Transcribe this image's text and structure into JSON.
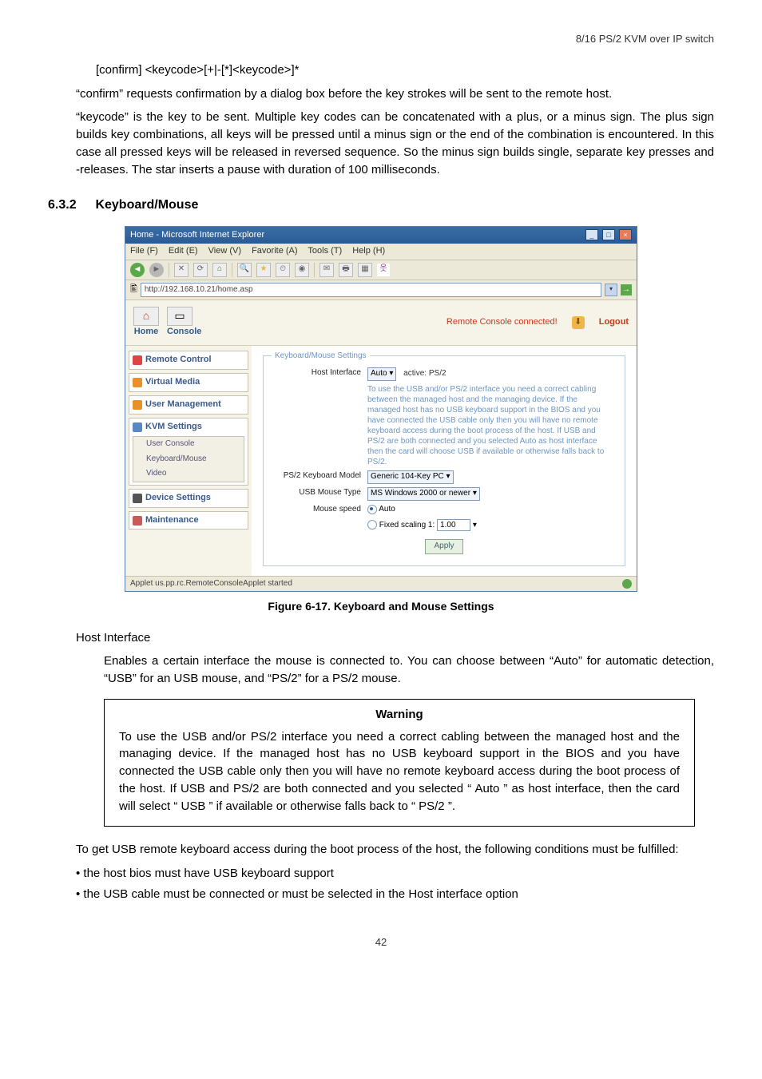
{
  "header_right": "8/16 PS/2 KVM over IP switch",
  "code_line": "[confirm] <keycode>[+|-[*]<keycode>]*",
  "para_confirm": "“confirm” requests confirmation by a dialog box before the key strokes will be sent to the remote host.",
  "para_keycode": "“keycode” is the key to be sent. Multiple key codes can be concatenated with a plus, or a minus sign. The plus sign builds key combinations, all keys will be pressed until a minus sign or the end of the combination is encountered. In this case all pressed keys will be released in reversed sequence. So the minus sign builds single, separate key presses and -releases. The star inserts a pause with duration of 100 milliseconds.",
  "section_num": "6.3.2",
  "section_title": "Keyboard/Mouse",
  "figure_caption": "Figure 6-17. Keyboard and Mouse Settings",
  "sub_heading": "Host Interface",
  "para_host_interface": "Enables a certain interface the mouse is connected to. You can choose between “Auto” for automatic detection, “USB” for an USB mouse, and “PS/2” for a PS/2 mouse.",
  "warning_title": "Warning",
  "warning_body": "To use the USB and/or PS/2 interface you need a correct cabling between the managed host and the managing device. If the managed host has no USB keyboard support in the BIOS and you have connected the USB cable only then you will have no remote keyboard access during the boot process of the host. If USB and PS/2 are both connected and you selected “ Auto ” as host interface, then the card will select “ USB ” if available or otherwise falls back to “ PS/2 ”.",
  "para_conditions": "To get USB remote keyboard access during the boot process of the host, the following conditions must be fulfilled:",
  "bullet1": "•  the host bios must have USB keyboard support",
  "bullet2": "•  the USB cable must be connected or must be selected in the Host interface option",
  "page_number": "42",
  "browser": {
    "title": "Home - Microsoft Internet Explorer",
    "menu": {
      "file": "File (F)",
      "edit": "Edit (E)",
      "view": "View (V)",
      "fav": "Favorite (A)",
      "tools": "Tools (T)",
      "help": "Help (H)"
    },
    "address": "http://192.168.10.21/home.asp",
    "header": {
      "home": "Home",
      "console": "Console",
      "status": "Remote Console connected!",
      "logout": "Logout"
    },
    "side": {
      "remote_control": "Remote Control",
      "virtual_media": "Virtual Media",
      "user_management": "User Management",
      "kvm_settings": "KVM Settings",
      "user_console": "User Console",
      "keyboard_mouse": "Keyboard/Mouse",
      "video": "Video",
      "device_settings": "Device Settings",
      "maintenance": "Maintenance"
    },
    "form": {
      "legend": "Keyboard/Mouse Settings",
      "host_interface_label": "Host Interface",
      "host_interface_value": "Auto",
      "active_label": "active: PS/2",
      "info": "To use the USB and/or PS/2 interface you need a correct cabling between the managed host and the managing device. If the managed host has no USB keyboard support in the BIOS and you have connected the USB cable only then you will have no remote keyboard access during the boot process of the host. If USB and PS/2 are both connected and you selected Auto as host interface then the card will choose USB if available or otherwise falls back to PS/2.",
      "ps2_model_label": "PS/2 Keyboard Model",
      "ps2_model_value": "Generic 104-Key PC",
      "usb_mouse_label": "USB Mouse Type",
      "usb_mouse_value": "MS Windows 2000 or newer",
      "mouse_speed_label": "Mouse speed",
      "mouse_speed_value": "Auto",
      "fixed_scaling_label": "Fixed scaling 1:",
      "fixed_scaling_value": "1.00",
      "apply": "Apply"
    },
    "statusbar": "Applet us.pp.rc.RemoteConsoleApplet started"
  }
}
